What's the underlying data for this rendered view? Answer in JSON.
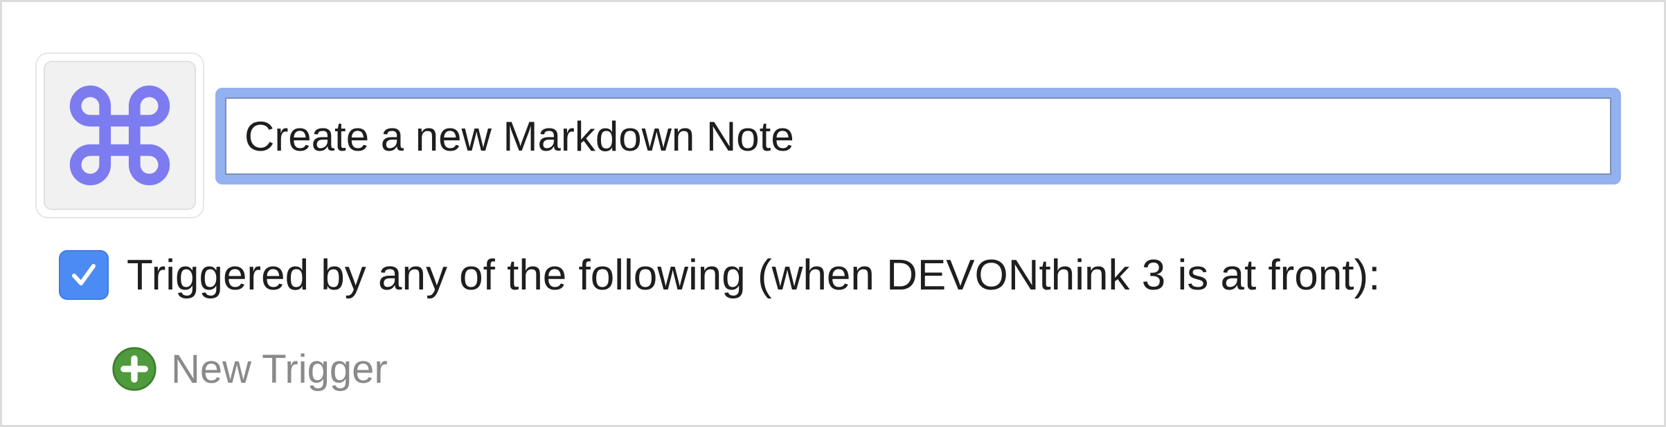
{
  "macro": {
    "icon": "command-key-icon",
    "name_value": "Create a new Markdown Note"
  },
  "trigger": {
    "checked": true,
    "label": "Triggered by any of the following (when DEVONthink 3 is at front):"
  },
  "new_trigger": {
    "icon": "plus-circle-icon",
    "label": "New Trigger"
  },
  "colors": {
    "focus_ring": "#93b0ef",
    "checkbox": "#4d8bf4",
    "command_icon": "#7d7bf0",
    "plus_icon": "#4e9a3c"
  }
}
